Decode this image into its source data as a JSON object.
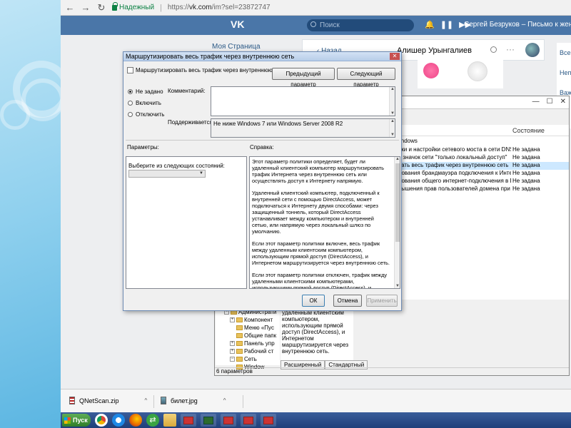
{
  "browser": {
    "secure_label": "Надежный",
    "url_scheme": "https://",
    "url_host": "vk.com",
    "url_path": "/im?sel=23872747"
  },
  "vk": {
    "logo": "VK",
    "search_placeholder": "Поиск",
    "user_text": "Сергей Безруков – Письмо к женщи...",
    "left_nav_first": "Моя Страница",
    "back_label": "Назад",
    "chat_name": "Алишер Урынгалиев",
    "right_items": [
      "Все",
      "Неп",
      "Важ"
    ]
  },
  "gpedit": {
    "column_state": "Состояние",
    "list_header_prefix": "indows",
    "rows": [
      {
        "name": "вки и настройки сетевого моста в сети DNS-до...",
        "state": "Не задана"
      },
      {
        "name": "ь значок сети \"только локальный доступ\"",
        "state": "Не задана"
      },
      {
        "name": "вать весь трафик через внутреннюю сеть",
        "state": "Не задана"
      },
      {
        "name": "рования брандмауэра подключения к Интерне...",
        "state": "Не задана"
      },
      {
        "name": "рования общего интернет-подключения в DNS...",
        "state": "Не задана"
      },
      {
        "name": "вышения прав пользователей домена при зада...",
        "state": "Не задана"
      }
    ],
    "tree": [
      "Администрати",
      "Компонент",
      "Меню «Пус",
      "Общие папк",
      "Панель упр",
      "Рабочий ст",
      "Сеть",
      "Window"
    ],
    "desc_text": "удаленным клиентским компьютером, использующим прямой доступ (DirectAccess), и Интернетом маршрутизируется через внутреннюю сеть.\n\nЕсли этот параметр политики отключен, трафик между удаленными клиентским",
    "tab_extended": "Расширенный",
    "tab_standard": "Стандартный",
    "status": "6 параметров"
  },
  "dialog": {
    "title": "Маршрутизировать весь трафик через внутреннюю сеть",
    "header": "Маршрутизировать весь трафик через внутреннюю сеть",
    "prev_button": "Предыдущий параметр",
    "next_button": "Следующий параметр",
    "radio_not_set": "Не задано",
    "radio_enable": "Включить",
    "radio_disable": "Отключить",
    "comment_label": "Комментарий:",
    "supported_label": "Поддерживается:",
    "supported_value": "Не ниже Windows 7 или Windows Server 2008 R2",
    "params_label": "Параметры:",
    "help_label": "Справка:",
    "select_state_label": "Выберите из следующих состояний:",
    "help_paragraphs": [
      "Этот параметр политики определяет, будет ли удаленный клиентский компьютер маршрутизировать трафик Интернета через внутреннюю сеть или осуществлять доступ к Интернету напрямую.",
      "Удаленный клиентский компьютер, подключенный к внутренней сети с помощью DirectAccess, может подключаться к Интернету двумя способами: через защищенный тоннель, который DirectAccess устанавливает между компьютером и внутренней сетью, или напрямую через локальный шлюз по умолчанию.",
      "Если этот параметр политики включен, весь трафик между удаленным клиентским компьютером, использующим прямой доступ (DirectAccess), и Интернетом маршрутизируется через внутреннюю сеть.",
      "Если этот параметр политики отключен, трафик между удаленными клиентскими компьютерами, использующими прямой доступ (DirectAccess), и Интернетом не маршрутизируется через внутреннюю сеть."
    ],
    "ok_button": "ОК",
    "cancel_button": "Отмена",
    "apply_button": "Применить"
  },
  "downloads": [
    {
      "name": "QNetScan.zip",
      "icon": "zip-file-icon"
    },
    {
      "name": "билет.jpg",
      "icon": "image-file-icon"
    }
  ],
  "taskbar": {
    "start_label": "Пуск"
  }
}
